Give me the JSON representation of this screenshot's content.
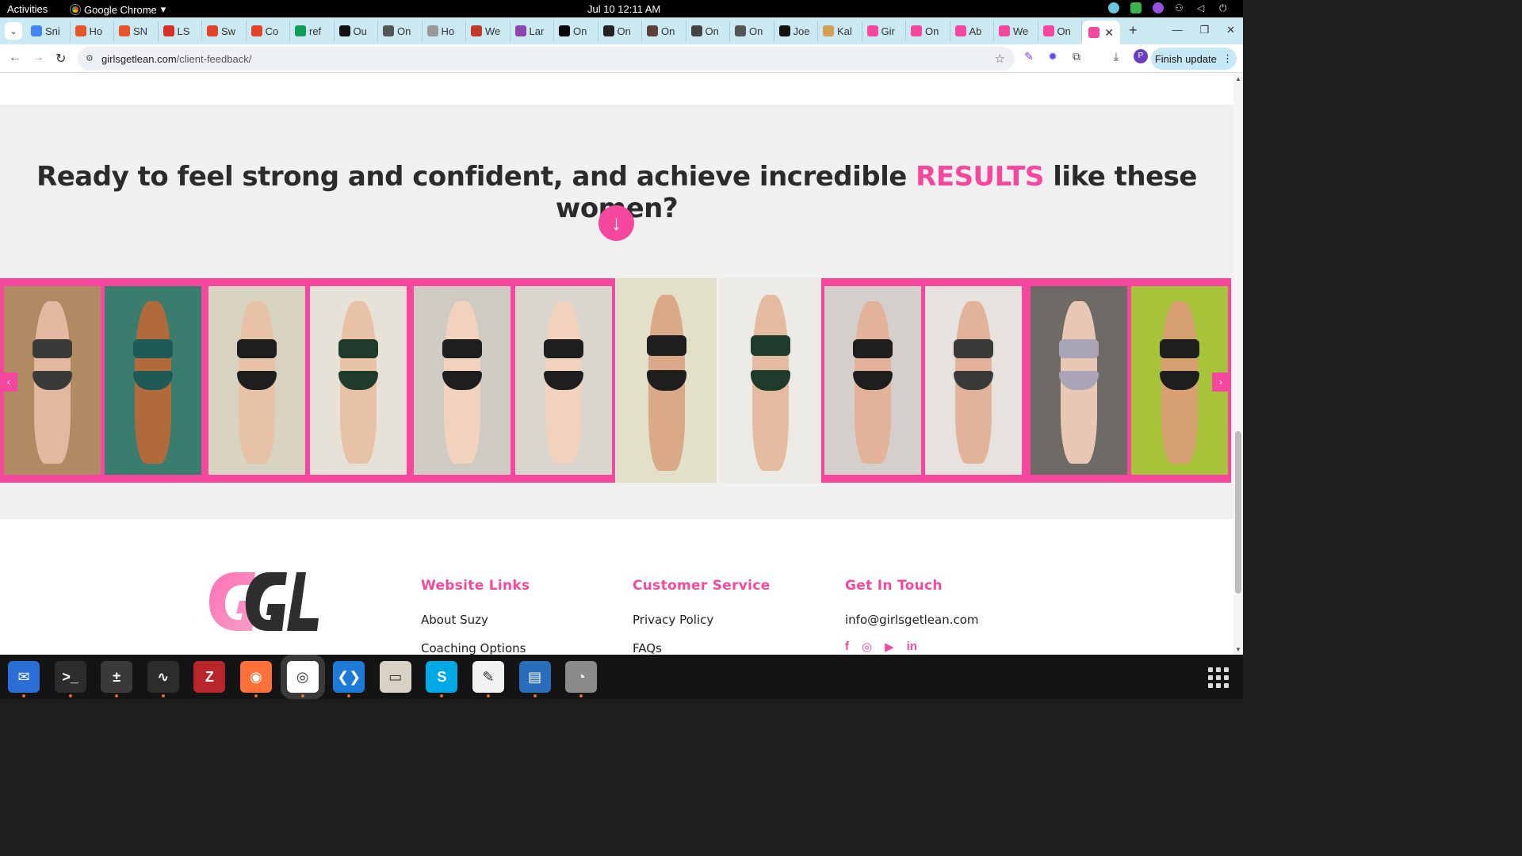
{
  "topbar": {
    "activities": "Activities",
    "app_name": "Google Chrome",
    "clock": "Jul 10  12:11 AM"
  },
  "tabs": [
    {
      "label": "Sni",
      "color": "#4285f4"
    },
    {
      "label": "Ho",
      "color": "#e8542a"
    },
    {
      "label": "SN",
      "color": "#e8542a"
    },
    {
      "label": "LS",
      "color": "#d93025"
    },
    {
      "label": "Sw",
      "color": "#e24329"
    },
    {
      "label": "Co",
      "color": "#e24329"
    },
    {
      "label": "ref",
      "color": "#0f9d58"
    },
    {
      "label": "Ou",
      "color": "#111111"
    },
    {
      "label": "On",
      "color": "#555555"
    },
    {
      "label": "Ho",
      "color": "#999999"
    },
    {
      "label": "We",
      "color": "#c0392b"
    },
    {
      "label": "Lar",
      "color": "#8e44ad"
    },
    {
      "label": "On",
      "color": "#000000"
    },
    {
      "label": "On",
      "color": "#222222"
    },
    {
      "label": "On",
      "color": "#5d4037"
    },
    {
      "label": "On",
      "color": "#444444"
    },
    {
      "label": "On",
      "color": "#555555"
    },
    {
      "label": "Joe",
      "color": "#111111"
    },
    {
      "label": "Kal",
      "color": "#d4a056"
    },
    {
      "label": "Gir",
      "color": "#f5479e"
    },
    {
      "label": "On",
      "color": "#f5479e"
    },
    {
      "label": "Ab",
      "color": "#f5479e"
    },
    {
      "label": "We",
      "color": "#f5479e"
    },
    {
      "label": "On",
      "color": "#f5479e"
    }
  ],
  "active_tab": {
    "close": "✕",
    "color": "#f5479e"
  },
  "toolbar": {
    "url_domain": "girlsgetlean.com",
    "url_path": "/client-feedback/",
    "profile_initial": "P",
    "finish_update": "Finish update"
  },
  "page": {
    "headline_before": "Ready to feel strong and confident, and achieve incredible ",
    "headline_highlight": "RESULTS",
    "headline_after": " like these women?",
    "accent_color": "#f5479e",
    "gallery_prev": "‹",
    "gallery_next": "›",
    "footer": {
      "col1_title": "Website Links",
      "col1_links": [
        "About Suzy",
        "Coaching Options"
      ],
      "col2_title": "Customer Service",
      "col2_links": [
        "Privacy Policy",
        "FAQs"
      ],
      "col3_title": "Get In Touch",
      "email": "info@girlsgetlean.com",
      "socials": [
        "facebook-icon",
        "instagram-icon",
        "youtube-icon",
        "linkedin-icon"
      ]
    }
  },
  "dock": [
    "thunderbird",
    "terminal",
    "calculator",
    "system-monitor",
    "filezilla",
    "firefox",
    "chrome",
    "vscode",
    "files",
    "skype",
    "text-editor",
    "libreoffice-writer",
    "disk-utility"
  ]
}
